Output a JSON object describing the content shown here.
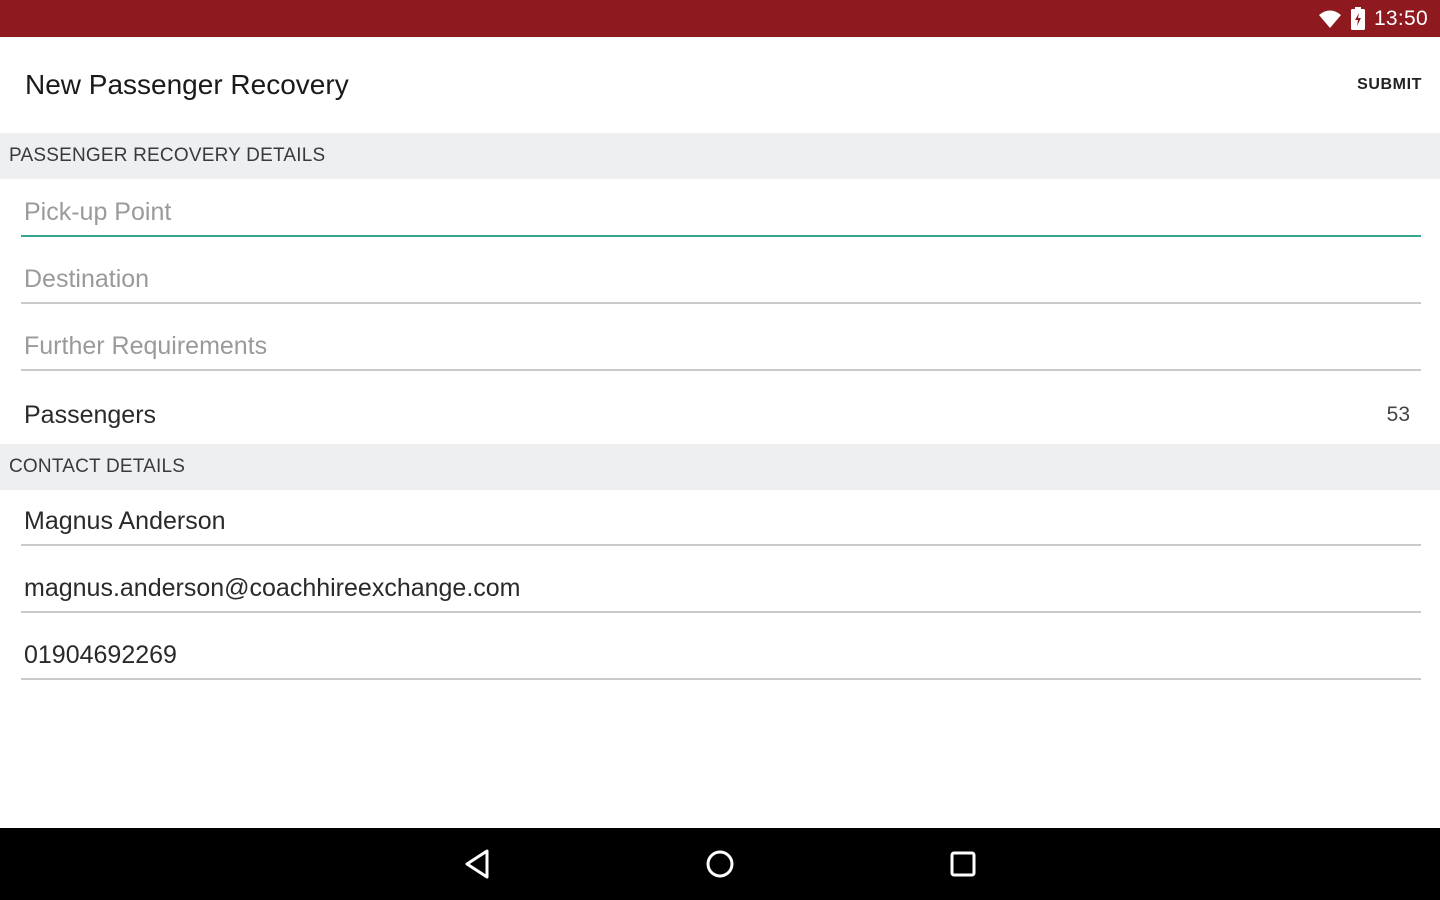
{
  "status_bar": {
    "time": "13:50",
    "icons": [
      "wifi-icon",
      "battery-icon"
    ]
  },
  "app_bar": {
    "title": "New Passenger Recovery",
    "submit_label": "SUBMIT"
  },
  "sections": {
    "recovery": {
      "header": "PASSENGER RECOVERY DETAILS",
      "pickup": {
        "placeholder": "Pick-up Point",
        "value": ""
      },
      "destination": {
        "placeholder": "Destination",
        "value": ""
      },
      "requirements": {
        "placeholder": "Further Requirements",
        "value": ""
      },
      "passengers": {
        "label": "Passengers",
        "value": "53"
      }
    },
    "contact": {
      "header": "CONTACT DETAILS",
      "name": {
        "value": "Magnus Anderson"
      },
      "email": {
        "value": "magnus.anderson@coachhireexchange.com"
      },
      "phone": {
        "value": "01904692269"
      }
    }
  },
  "nav_bar": {
    "icons": [
      "back-icon",
      "home-icon",
      "recent-apps-icon"
    ]
  },
  "colors": {
    "status_bar": "#8e1a1f",
    "focus_underline": "#3aa591",
    "section_background": "#eeeff1"
  }
}
